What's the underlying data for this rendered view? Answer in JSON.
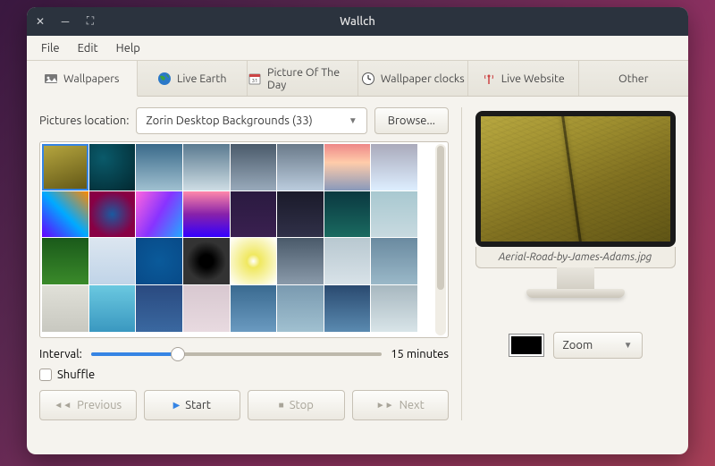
{
  "window": {
    "title": "Wallch"
  },
  "menu": [
    "File",
    "Edit",
    "Help"
  ],
  "tabs": [
    {
      "label": "Wallpapers",
      "icon": "wallpapers-icon"
    },
    {
      "label": "Live Earth",
      "icon": "globe-icon"
    },
    {
      "label": "Picture Of The Day",
      "icon": "calendar-icon"
    },
    {
      "label": "Wallpaper clocks",
      "icon": "clock-icon"
    },
    {
      "label": "Live Website",
      "icon": "antenna-icon"
    },
    {
      "label": "Other",
      "icon": ""
    }
  ],
  "location": {
    "label": "Pictures location:",
    "value": "Zorin Desktop Backgrounds (33)",
    "browse": "Browse..."
  },
  "interval": {
    "label": "Interval:",
    "text": "15 minutes"
  },
  "shuffle": {
    "label": "Shuffle"
  },
  "controls": {
    "previous": "Previous",
    "start": "Start",
    "stop": "Stop",
    "next": "Next"
  },
  "preview": {
    "filename": "Aerial-Road-by-James-Adams.jpg",
    "mode": "Zoom",
    "bgcolor": "#000000"
  },
  "thumbs": [
    {
      "c": "linear-gradient(160deg,#b8a840,#605515)"
    },
    {
      "c": "radial-gradient(circle at 30% 30%,#0a5a6a,#022830)"
    },
    {
      "c": "linear-gradient(#3a6a8a,#a0c0d0)"
    },
    {
      "c": "linear-gradient(#5a7a90,#cedde4)"
    },
    {
      "c": "linear-gradient(#4a5a6a,#9ab)"
    },
    {
      "c": "linear-gradient(#6a7a8a,#bcd)"
    },
    {
      "c": "linear-gradient(#e88,#fca 40%,#89b)"
    },
    {
      "c": "linear-gradient(#aab,#def)"
    },
    {
      "c": "linear-gradient(45deg,#60f,#0af,#f80)"
    },
    {
      "c": "radial-gradient(#1a5aa0,#804 70%)"
    },
    {
      "c": "linear-gradient(120deg,#f6d,#83f,#2af)"
    },
    {
      "c": "linear-gradient(#f8a,#82a 50%,#30f)"
    },
    {
      "c": "linear-gradient(#2a1a40,#3a2050)"
    },
    {
      "c": "linear-gradient(#1a1a2a,#303048)"
    },
    {
      "c": "linear-gradient(#0a3840,#1a6a60)"
    },
    {
      "c": "linear-gradient(#a8c8d0,#c8dae0)"
    },
    {
      "c": "linear-gradient(#1a5a1a,#3a8a2a)"
    },
    {
      "c": "linear-gradient(#dce6f0,#c0d4e8)"
    },
    {
      "c": "radial-gradient(#0a5a9a,#084a88)"
    },
    {
      "c": "radial-gradient(circle,#000 20%,#333 60%)"
    },
    {
      "c": "radial-gradient(#fff,#f0e860 20%,#fff)"
    },
    {
      "c": "linear-gradient(#4a5a6a,#8a9aaa)"
    },
    {
      "c": "linear-gradient(#b8c8d0,#d8e2e8)"
    },
    {
      "c": "linear-gradient(#6a8aa0,#9ab8c8)"
    },
    {
      "c": "linear-gradient(#e0e0d8,#c8c8c0)"
    },
    {
      "c": "linear-gradient(#6ac8e0,#3a98c0)"
    },
    {
      "c": "linear-gradient(#2a4a80,#3a68a0)"
    },
    {
      "c": "linear-gradient(#d8c8d0,#e8dae0)"
    },
    {
      "c": "linear-gradient(#3a6a90,#6a9ac0)"
    },
    {
      "c": "linear-gradient(#7a9ab0,#a0c0d0)"
    },
    {
      "c": "linear-gradient(#2a4a70,#5a8ab0)"
    },
    {
      "c": "linear-gradient(#a8b8c0,#d8e4e8)"
    }
  ]
}
